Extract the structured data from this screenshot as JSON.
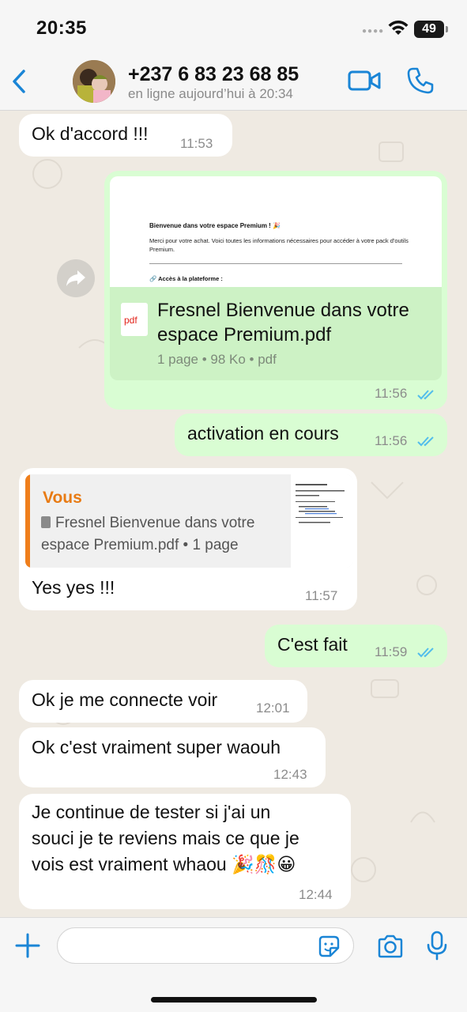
{
  "status_bar": {
    "time": "20:35",
    "battery": "49"
  },
  "header": {
    "contact_name": "+237 6 83 23 68 85",
    "contact_status": "en ligne aujourd’hui à 20:34"
  },
  "messages": [
    {
      "text": "Ok d'accord !!!",
      "time": "11:53"
    },
    {
      "preview_title": "Bienvenue dans votre espace Premium ! 🎉",
      "preview_body": "Merci pour votre achat. Voici toutes les informations nécessaires pour accéder à votre pack d'outils Premium.",
      "preview_access": "🔗 Accès à la plateforme :",
      "file_icon_label": "pdf",
      "file_name": "Fresnel Bienvenue dans votre espace Premium.pdf",
      "file_meta": "1 page • 98 Ko • pdf",
      "time": "11:56"
    },
    {
      "text": "activation en cours",
      "time": "11:56"
    },
    {
      "reply_author": "Vous",
      "reply_text": "Fresnel Bienvenue dans votre espace Premium.pdf • 1 page",
      "text": "Yes yes !!!",
      "time": "11:57"
    },
    {
      "text": "C'est fait",
      "time": "11:59"
    },
    {
      "text": "Ok je me connecte voir",
      "time": "12:01"
    },
    {
      "text": "Ok c'est vraiment super waouh",
      "time": "12:43"
    },
    {
      "lines": [
        "Je continue de tester si j'ai un",
        "souci je te reviens mais ce que je",
        "vois est vraiment whaou 🎉🎊😀"
      ],
      "time": "12:44"
    }
  ],
  "composer": {
    "placeholder": ""
  },
  "colors": {
    "accent": "#1a85d6",
    "outgoing_bubble": "#d9fdd3",
    "read_ticks": "#53bdeb",
    "reply_author": "#e87b14"
  }
}
